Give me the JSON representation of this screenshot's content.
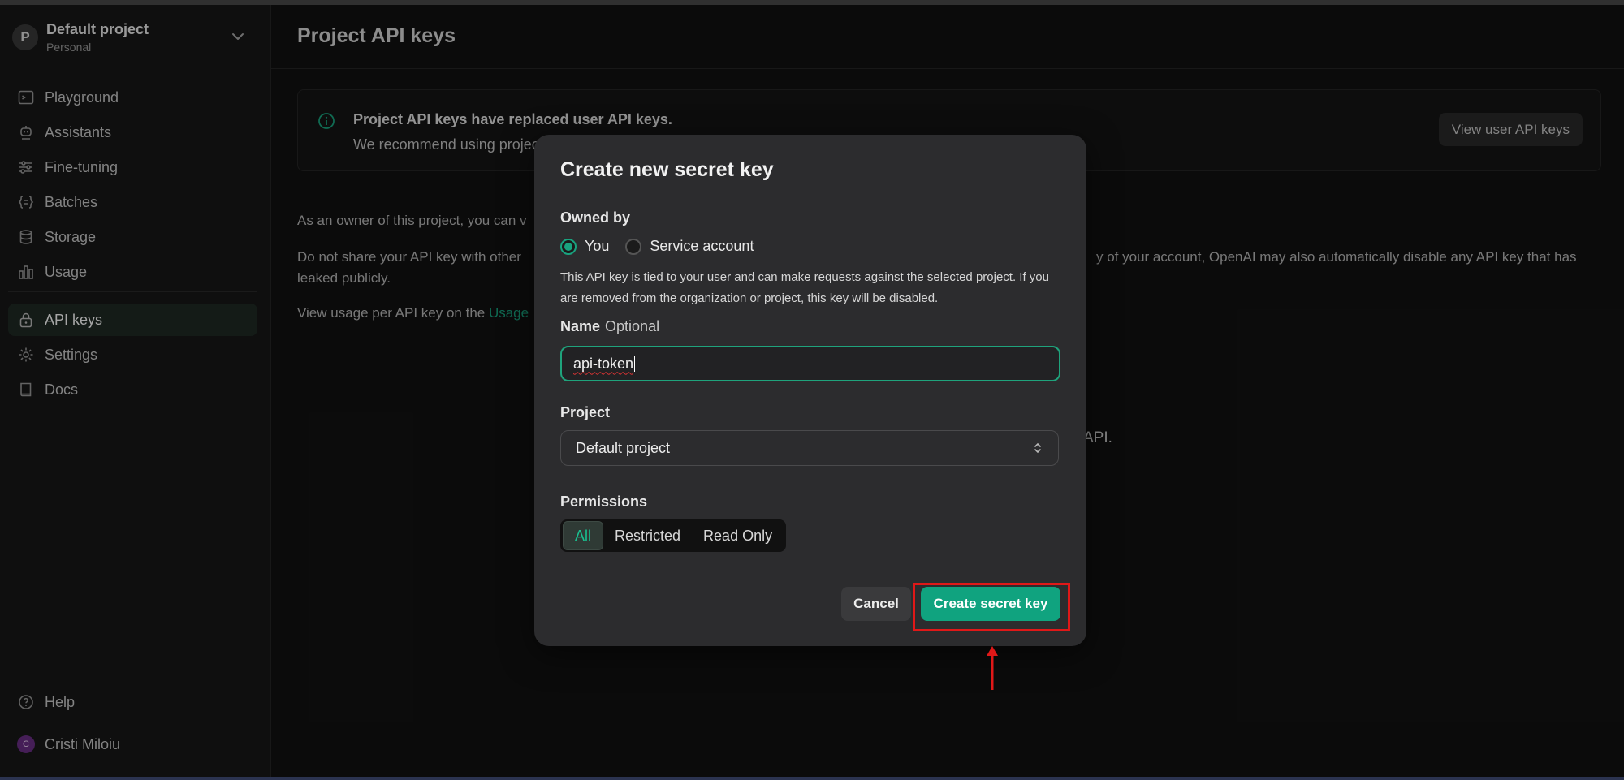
{
  "project": {
    "initial": "P",
    "name": "Default project",
    "sub": "Personal"
  },
  "nav": {
    "playground": "Playground",
    "assistants": "Assistants",
    "finetuning": "Fine-tuning",
    "batches": "Batches",
    "storage": "Storage",
    "usage": "Usage",
    "apikeys": "API keys",
    "settings": "Settings",
    "docs": "Docs",
    "help": "Help"
  },
  "user": {
    "initial": "C",
    "name": "Cristi Miloiu"
  },
  "page": {
    "title": "Project API keys",
    "banner_title": "Project API keys have replaced user API keys.",
    "banner_text": "We recommend using projec",
    "view_user_keys": "View user API keys",
    "para1": "As an owner of this project, you can v",
    "para2a": "Do not share your API key with other",
    "para2b": "leaked publicly.",
    "para2_right": "y of your account, OpenAI may also automatically disable any API key that has",
    "para3": "View usage per API key on the ",
    "para3_link": "Usage",
    "empty_fragment": "API."
  },
  "modal": {
    "title": "Create new secret key",
    "owned_by_label": "Owned by",
    "owner_you": "You",
    "owner_service": "Service account",
    "description": "This API key is tied to your user and can make requests against the selected project. If you are removed from the organization or project, this key will be disabled.",
    "name_label": "Name",
    "name_optional": "Optional",
    "name_value": "api-token",
    "project_label": "Project",
    "project_value": "Default project",
    "permissions_label": "Permissions",
    "perm_all": "All",
    "perm_restricted": "Restricted",
    "perm_readonly": "Read Only",
    "cancel": "Cancel",
    "create": "Create secret key"
  },
  "colors": {
    "accent": "#10a37f",
    "annotation": "#e01818"
  }
}
